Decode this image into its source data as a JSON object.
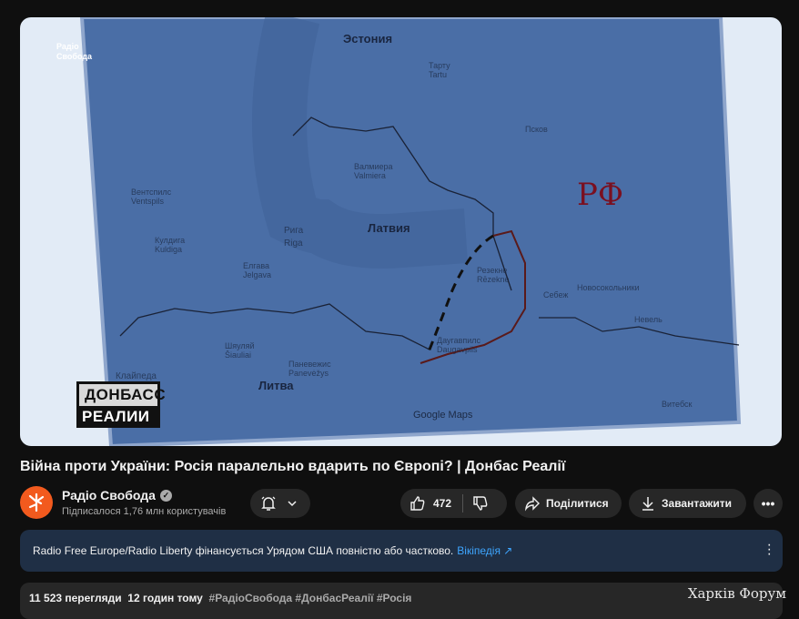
{
  "video": {
    "logo_text": [
      "Радіо",
      "Свобода"
    ],
    "badge": [
      "ДОНБАСС",
      "РЕАЛИИ"
    ],
    "map_labels": [
      "Эстония",
      "Латвия",
      "Литва",
      "Рига",
      "Riga",
      "Псков",
      "Елгава",
      "Jelgava",
      "Шяуляй",
      "Šiauliai",
      "Паневежис",
      "Panevėžys",
      "Даугавпилс",
      "Daugavpils",
      "Резекне",
      "Rēzekne",
      "Вентспилс",
      "Ventspils",
      "Кулдига",
      "Kuldiga",
      "Клайпеда",
      "Валмиера",
      "Valmiera",
      "Тарту",
      "Tartu",
      "Новосокольники",
      "Себеж",
      "Невель",
      "Витебск"
    ],
    "google_maps": "Google Maps",
    "handwritten": "РФ"
  },
  "title": "Війна проти України: Росія паралельно вдарить по Європі?  | Донбас Реалії",
  "channel": {
    "name": "Радіо Свобода",
    "subscribers": "Підписалося 1,76 млн користувачів",
    "verified": true
  },
  "actions": {
    "likes": "472",
    "share": "Поділитися",
    "download": "Завантажити"
  },
  "icons": [
    "bell-icon",
    "chevron-down-icon",
    "thumbs-up-icon",
    "thumbs-down-icon",
    "share-icon",
    "download-icon",
    "more-icon"
  ],
  "banner": {
    "text": "Radio Free Europe/Radio Liberty фінансується Урядом США повністю або частково.",
    "link": "Вікіпедія ↗"
  },
  "description": {
    "views": "11 523 перегляди",
    "time": "12 годин тому",
    "tags": "#РадіоСвобода #ДонбасРеалії #Росія"
  },
  "watermark": "Харків Форум",
  "colors": {
    "background": "#0f0f0f",
    "button": "#272727",
    "banner": "#1f2f45",
    "link": "#3ea6ff",
    "channel_avatar": "#f25a1e"
  }
}
